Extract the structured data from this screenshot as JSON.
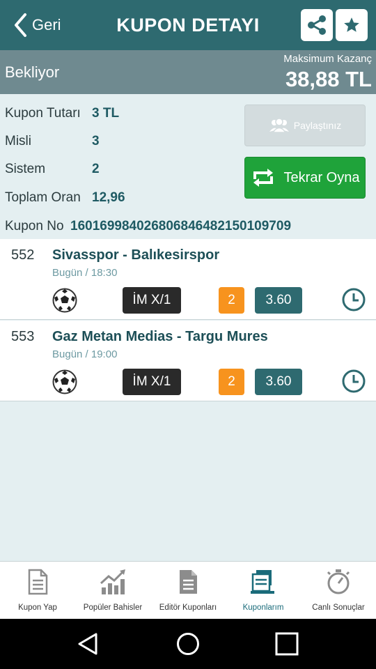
{
  "header": {
    "back_label": "Geri",
    "title": "KUPON DETAYI"
  },
  "status": {
    "text": "Bekliyor",
    "max_label": "Maksimum Kazanç",
    "max_value": "38,88 TL"
  },
  "coupon": {
    "amount_label": "Kupon Tutarı",
    "amount_value": "3 TL",
    "multiplier_label": "Misli",
    "multiplier_value": "3",
    "system_label": "Sistem",
    "system_value": "2",
    "total_odds_label": "Toplam Oran",
    "total_odds_value": "12,96",
    "number_label": "Kupon No",
    "number_value": "16016998402680684648215010970​9"
  },
  "buttons": {
    "shared_label": "Paylaştınız",
    "replay_label": "Tekrar Oyna"
  },
  "matches": [
    {
      "code": "552",
      "teams": "Sivasspor - Balıkesirspor",
      "time": "Bugün / 18:30",
      "market": "İM X/1",
      "pick": "2",
      "odd": "3.60"
    },
    {
      "code": "553",
      "teams": "Gaz Metan Medias - Targu Mures",
      "time": "Bugün / 19:00",
      "market": "İM X/1",
      "pick": "2",
      "odd": "3.60"
    }
  ],
  "bottom_nav": {
    "items": [
      {
        "label": "Kupon Yap",
        "icon": "document-icon"
      },
      {
        "label": "Popüler Bahisler",
        "icon": "trending-chart-icon"
      },
      {
        "label": "Editör Kuponları",
        "icon": "editor-document-icon"
      },
      {
        "label": "Kuponlarım",
        "icon": "stacked-coupons-icon",
        "active": true
      },
      {
        "label": "Canlı Sonuçlar",
        "icon": "stopwatch-icon"
      }
    ]
  },
  "colors": {
    "header": "#2e6a70",
    "status_bar": "#6f8a90",
    "accent_green": "#1fa33a",
    "pick_orange": "#f7931e",
    "odd_teal": "#2e6a70"
  }
}
